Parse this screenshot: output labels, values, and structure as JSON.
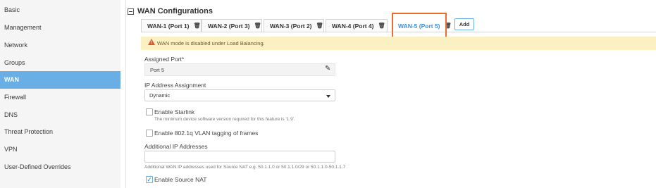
{
  "sidebar": {
    "items": [
      {
        "label": "Basic",
        "active": false
      },
      {
        "label": "Management",
        "active": false
      },
      {
        "label": "Network",
        "active": false
      },
      {
        "label": "Groups",
        "active": false
      },
      {
        "label": "WAN",
        "active": true
      },
      {
        "label": "Firewall",
        "active": false
      },
      {
        "label": "DNS",
        "active": false
      },
      {
        "label": "Threat Protection",
        "active": false
      },
      {
        "label": "VPN",
        "active": false
      },
      {
        "label": "User-Defined Overrides",
        "active": false
      }
    ]
  },
  "section": {
    "title": "WAN Configurations"
  },
  "tabs": [
    {
      "label": "WAN-1 (Port 1)",
      "icon": "trash-icon",
      "active": false
    },
    {
      "label": "WAN-2 (Port 3)",
      "icon": "trash-icon",
      "active": false
    },
    {
      "label": "WAN-3 (Port 2)",
      "icon": "trash-icon",
      "active": false
    },
    {
      "label": "WAN-4 (Port 4)",
      "icon": "trash-icon",
      "active": false
    },
    {
      "label": "WAN-5 (Port 5)",
      "icon": "trash-icon",
      "active": true
    }
  ],
  "add_button": "Add",
  "banner": {
    "icon": "warning-icon",
    "text": "WAN mode is disabled under Load Balancing."
  },
  "form": {
    "assigned_port": {
      "label": "Assigned Port*",
      "value": "Port 5",
      "icon": "pencil-icon"
    },
    "ip_assignment": {
      "label": "IP Address Assignment",
      "value": "Dynamic"
    },
    "starlink": {
      "label": "Enable Starlink",
      "help": "The minimum device software version required for this feature is '1.9'.",
      "checked": false
    },
    "vlan": {
      "label": "Enable 802.1q VLAN tagging of frames",
      "checked": false
    },
    "additional_ip": {
      "label": "Additional IP Addresses",
      "value": "",
      "help": "Additional WAN IP addresses used for Source NAT e.g. 50.1.1.0 or 50.1.1.0/29 or 50.1.1.0-50.1.1.7"
    },
    "source_nat": {
      "label": "Enable Source NAT",
      "checked": true
    }
  },
  "colors": {
    "accent": "#6aaee6",
    "active_tab_text": "#3f8fdc",
    "highlight_box": "#f06a2a",
    "banner_bg": "#fbf0c2",
    "warning": "#e0582b"
  }
}
